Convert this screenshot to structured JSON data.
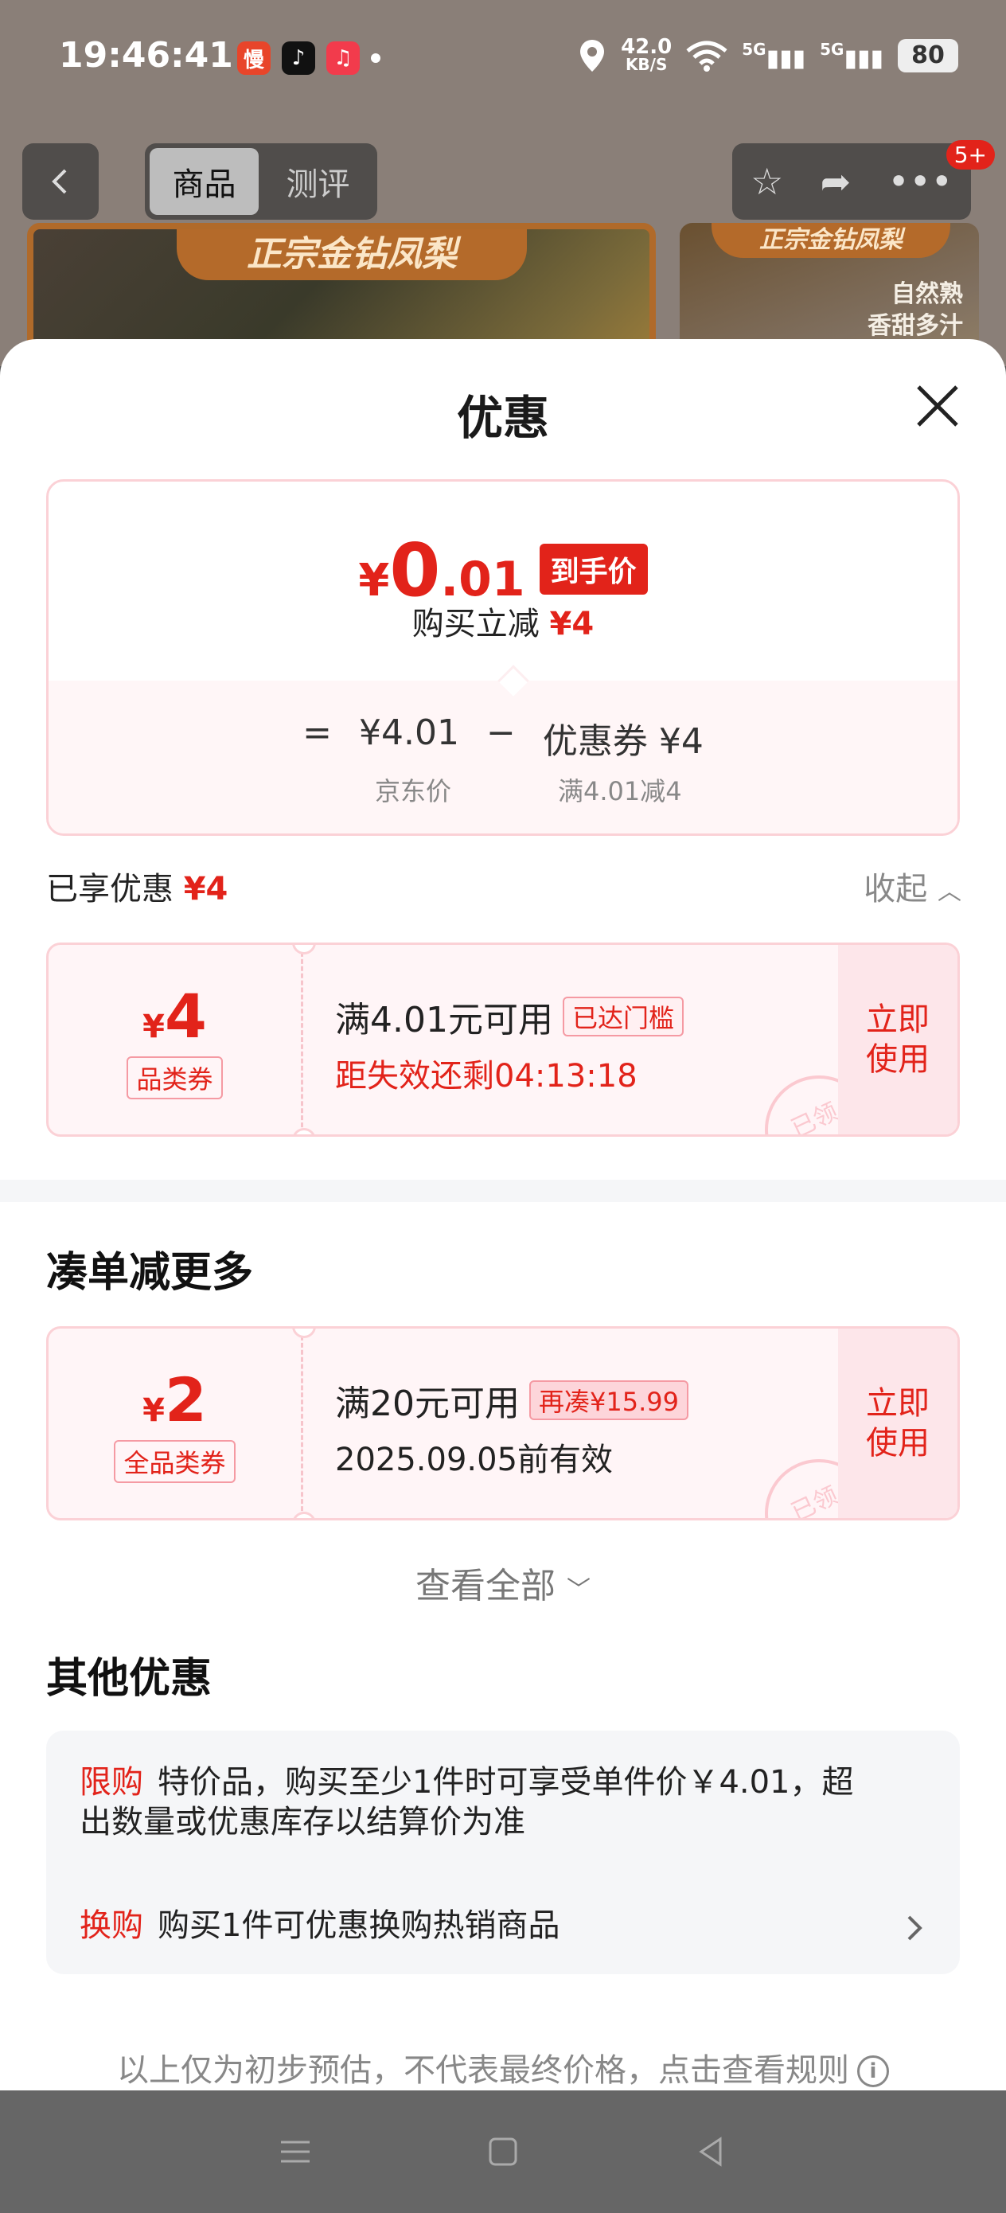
{
  "status_bar": {
    "time": "19:46:41",
    "net_speed_value": "42.0",
    "net_speed_unit": "KB/S",
    "signal1": "5G",
    "signal2": "5G",
    "battery": "80",
    "app_icons": [
      "慢",
      "♪",
      "♫"
    ]
  },
  "nav": {
    "tabs": [
      "商品",
      "测评"
    ],
    "badge": "5+"
  },
  "background": {
    "banner_main": "正宗金钻凤梨",
    "banner_side": "正宗金钻凤梨",
    "side_text_1": "自然熟",
    "side_text_2": "香甜多汁"
  },
  "sheet": {
    "title": "优惠",
    "final_price_symbol": "¥",
    "final_price_int": "0",
    "final_price_dec": ".01",
    "final_price_tag": "到手价",
    "reduce_label": "购买立减",
    "reduce_value": "¥4",
    "calc": {
      "eq": "=",
      "jd_price": "¥4.01",
      "minus": "−",
      "coupon_label": "优惠券 ¥4",
      "jd_price_label": "京东价",
      "coupon_rule": "满4.01减4"
    },
    "enjoyed_label": "已享优惠",
    "enjoyed_value": "¥4",
    "collapse_label": "收起"
  },
  "coupons_applied": [
    {
      "symbol": "¥",
      "amount": "4",
      "type": "品类券",
      "condition": "满4.01元可用",
      "tag": "已达门槛",
      "time": "距失效还剩04:13:18",
      "use_label_1": "立即",
      "use_label_2": "使用",
      "stamp": "已领"
    }
  ],
  "more_section": {
    "title": "凑单减更多",
    "coupons": [
      {
        "symbol": "¥",
        "amount": "2",
        "type": "全品类券",
        "condition": "满20元可用",
        "tag": "再凑¥15.99",
        "time": "2025.09.05前有效",
        "use_label_1": "立即",
        "use_label_2": "使用",
        "stamp": "已领"
      }
    ],
    "view_all": "查看全部"
  },
  "other_section": {
    "title": "其他优惠",
    "items": [
      {
        "label": "限购",
        "text_line1": "特价品，购买至少1件时可享受单件价￥4.01，超",
        "text_line2": "出数量或优惠库存以结算价为准"
      },
      {
        "label": "换购",
        "text_line1": "购买1件可优惠换购热销商品"
      }
    ]
  },
  "footer_note": "以上仅为初步预估，不代表最终价格，点击查看规则",
  "colors": {
    "accent": "#e2231a",
    "coupon_bg": "#fff5f7",
    "coupon_border": "#fbd1d6"
  }
}
